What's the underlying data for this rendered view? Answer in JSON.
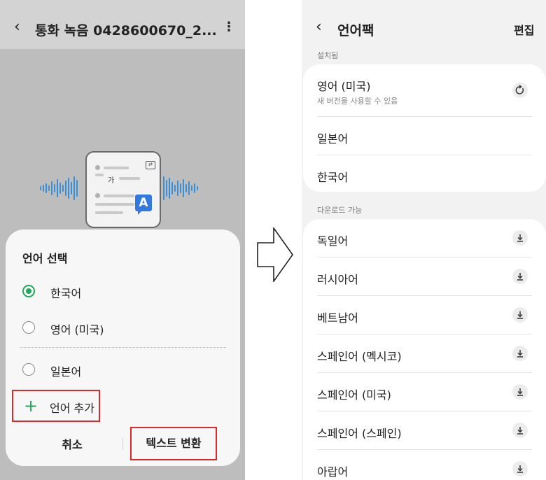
{
  "left": {
    "title": "통화 녹음 0428600670_2...",
    "illustration": {
      "glyph_ga": "가",
      "badge_letter": "A"
    },
    "sheet": {
      "title": "언어 선택",
      "options": [
        {
          "label": "한국어",
          "selected": true
        },
        {
          "label": "영어 (미국)",
          "selected": false
        },
        {
          "label": "일본어",
          "selected": false
        }
      ],
      "add_label": "언어 추가",
      "cancel_label": "취소",
      "convert_label": "텍스트 변환"
    }
  },
  "right": {
    "title": "언어팩",
    "edit_label": "편집",
    "installed_label": "설치됨",
    "installed": [
      {
        "label": "영어 (미국)",
        "sub": "새 버전을 사용할 수 있음",
        "icon": "update-icon"
      },
      {
        "label": "일본어"
      },
      {
        "label": "한국어"
      }
    ],
    "available_label": "다운로드 가능",
    "available": [
      {
        "label": "독일어",
        "icon": "download-icon"
      },
      {
        "label": "러시아어",
        "icon": "download-icon"
      },
      {
        "label": "베트남어",
        "icon": "download-icon"
      },
      {
        "label": "스페인어 (멕시코)",
        "icon": "download-icon"
      },
      {
        "label": "스페인어 (미국)",
        "icon": "download-icon"
      },
      {
        "label": "스페인어 (스페인)",
        "icon": "download-icon"
      },
      {
        "label": "아랍어",
        "icon": "download-icon"
      }
    ]
  },
  "colors": {
    "accent_green": "#1faa59",
    "highlight_red": "#e0262b",
    "badge_blue": "#3179e0",
    "wave_blue": "#3a8fd6"
  }
}
